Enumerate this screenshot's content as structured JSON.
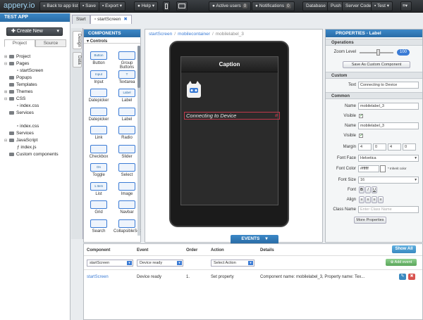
{
  "topbar": {
    "logo": "appery.io",
    "back": "« Back to app list",
    "save": "Save",
    "export": "Export",
    "help": "Help",
    "active_users": "Active users",
    "active_count": "0",
    "notifications": "Notifications",
    "notif_count": "0",
    "database": "Database",
    "push": "Push",
    "server_code": "Server Code",
    "test": "Test"
  },
  "left": {
    "title": "TEST APP",
    "create": "Create New",
    "tabs": [
      "Project",
      "Source"
    ],
    "tree": [
      "Project",
      "Pages",
      "startScreen",
      "Popups",
      "Templates",
      "Themes",
      "CSS",
      "index.css",
      "Services",
      "index.css",
      "Services",
      "JavaScript",
      "index.js",
      "Custom components"
    ]
  },
  "editor_tabs": {
    "start": "Start",
    "screen": "startScreen"
  },
  "side_tabs": [
    "Design",
    "Data"
  ],
  "components": {
    "title": "COMPONENTS",
    "section": "Controls",
    "items": [
      "Button",
      "Group Buttons",
      "Input",
      "Textarea",
      "Datepicker",
      "Label",
      "Datepicker",
      "Label",
      "Link",
      "Radio",
      "Checkbox",
      "Slider",
      "Toggle",
      "Select",
      "List",
      "Image",
      "Grid",
      "Navbar",
      "Search",
      "CollapsibleSet"
    ],
    "icon_text": [
      "Button",
      "",
      "Input",
      "T",
      "",
      "Label",
      "",
      "",
      "",
      "",
      "",
      "",
      "On",
      "",
      "1.Item",
      "",
      "",
      "",
      "",
      ""
    ]
  },
  "canvas": {
    "breadcrumb": [
      "startScreen",
      "mobilecontainer",
      "mobilelabel_3"
    ],
    "caption": "Caption",
    "label": "Connecting to Device",
    "events_tab": "EVENTS"
  },
  "props": {
    "title": "PROPERTIES - Label",
    "operations": "Operations",
    "zoom_label": "Zoom Level",
    "zoom": "100",
    "save_custom": "Save As Custom Component",
    "custom": "Custom",
    "text_label": "Text",
    "text": "Connecting to Device",
    "common": "Common",
    "name_label": "Name",
    "name": "mobilelabel_3",
    "visible_label": "Visible",
    "name2": "mobilelabel_3",
    "margin_label": "Margin",
    "margins": [
      "4",
      "0",
      "4",
      "0"
    ],
    "font_face_label": "Font Face",
    "font_face": "Helvetica",
    "font_color_label": "Font Color",
    "font_color": "#ffffff",
    "inherit": "Inherit color",
    "font_size_label": "Font Size",
    "font_size": "16",
    "font_label": "Font",
    "font_btns": [
      "B",
      "I",
      "U"
    ],
    "align_label": "Align",
    "class_label": "Class Name",
    "class_placeholder": "Enter Class Name",
    "more": "More Properties"
  },
  "events": {
    "headers": [
      "Component",
      "Event",
      "Order",
      "Action",
      "Details"
    ],
    "show_all": "Show All",
    "add_event": "Add event",
    "sel_component": "startScreen",
    "sel_event": "Device ready",
    "sel_action": "Select Action",
    "row": {
      "component": "startScreen",
      "event": "Device ready",
      "order": "1.",
      "action": "Set property",
      "details": "Component name: mobilelabel_3, Property name: Tex..."
    }
  }
}
